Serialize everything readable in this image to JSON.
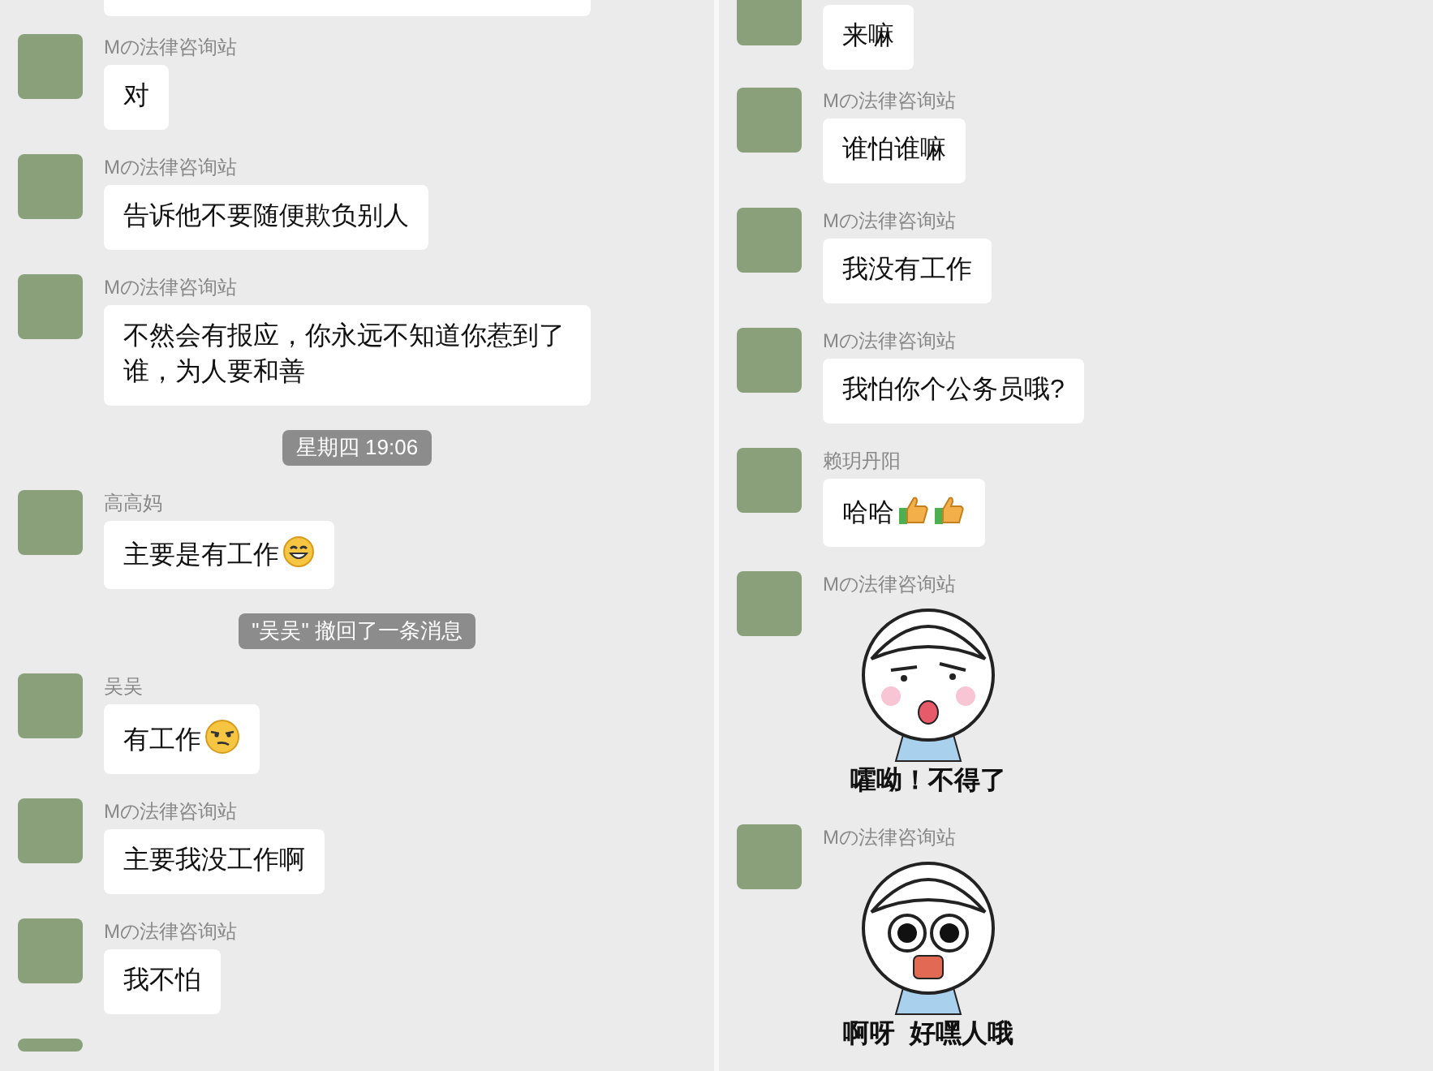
{
  "panels": [
    {
      "items": [
        {
          "kind": "cut_bubble"
        },
        {
          "kind": "message",
          "sender": "Mの法律咨询站",
          "text": "对"
        },
        {
          "kind": "message",
          "sender": "Mの法律咨询站",
          "text": "告诉他不要随便欺负别人"
        },
        {
          "kind": "message",
          "sender": "Mの法律咨询站",
          "text": "不然会有报应，你永远不知道你惹到了谁，为人要和善"
        },
        {
          "kind": "timestamp",
          "text": "星期四 19:06"
        },
        {
          "kind": "message",
          "sender": "高高妈",
          "text": "主要是有工作",
          "icons": [
            {
              "kind": "grin"
            }
          ]
        },
        {
          "kind": "notice",
          "text": "\"吴吴\" 撤回了一条消息"
        },
        {
          "kind": "message",
          "sender": "吴吴",
          "text": "有工作",
          "icons": [
            {
              "kind": "smirk"
            }
          ]
        },
        {
          "kind": "message",
          "sender": "Mの法律咨询站",
          "text": "主要我没工作啊"
        },
        {
          "kind": "message",
          "sender": "Mの法律咨询站",
          "text": "我不怕"
        },
        {
          "kind": "cut_avatar"
        }
      ]
    },
    {
      "items": [
        {
          "kind": "cut_top",
          "text": "来嘛"
        },
        {
          "kind": "message",
          "sender": "Mの法律咨询站",
          "text": "谁怕谁嘛"
        },
        {
          "kind": "message",
          "sender": "Mの法律咨询站",
          "text": "我没有工作"
        },
        {
          "kind": "message",
          "sender": "Mの法律咨询站",
          "text": "我怕你个公务员哦?"
        },
        {
          "kind": "message",
          "sender": "赖玥丹阳",
          "text": "哈哈",
          "icons": [
            {
              "kind": "thumb"
            },
            {
              "kind": "thumb"
            }
          ]
        },
        {
          "kind": "sticker",
          "sender": "Mの法律咨询站",
          "caption": "嚯呦！不得了"
        },
        {
          "kind": "sticker",
          "sender": "Mの法律咨询站",
          "caption": "啊呀  好嘿人哦"
        }
      ]
    }
  ]
}
